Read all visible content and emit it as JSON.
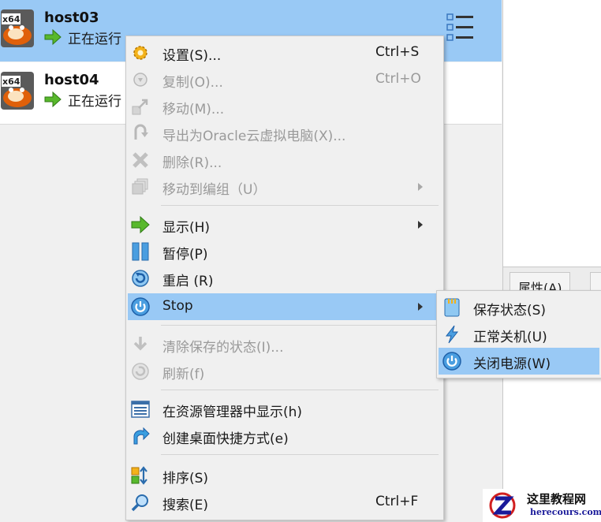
{
  "vms": [
    {
      "name": "host03",
      "status": "正在运行",
      "os_badge": "x64"
    },
    {
      "name": "host04",
      "status": "正在运行",
      "os_badge": "x64"
    }
  ],
  "right_panel": {
    "tab_properties": "属性(A)"
  },
  "context_menu": {
    "items": [
      {
        "label": "设置(S)...",
        "shortcut": "Ctrl+S",
        "icon": "gear-icon",
        "enabled": true
      },
      {
        "label": "复制(O)...",
        "shortcut": "Ctrl+O",
        "icon": "clone-icon",
        "enabled": false
      },
      {
        "label": "移动(M)...",
        "icon": "move-icon",
        "enabled": false
      },
      {
        "label": "导出为Oracle云虚拟电脑(X)...",
        "icon": "export-cloud-icon",
        "enabled": false
      },
      {
        "label": "删除(R)...",
        "icon": "delete-icon",
        "enabled": false
      },
      {
        "label": "移动到编组（U）",
        "icon": "group-icon",
        "enabled": false,
        "submenu": true
      },
      {
        "label": "显示(H)",
        "icon": "show-arrow-icon",
        "enabled": true,
        "submenu": true
      },
      {
        "label": "暂停(P)",
        "icon": "pause-icon",
        "enabled": true
      },
      {
        "label": "重启 (R)",
        "icon": "reset-icon",
        "enabled": true
      },
      {
        "label": "Stop",
        "icon": "power-icon",
        "enabled": true,
        "submenu": true,
        "highlighted": true
      },
      {
        "label": "清除保存的状态(I)...",
        "icon": "discard-state-icon",
        "enabled": false
      },
      {
        "label": "刷新(f)",
        "icon": "refresh-icon",
        "enabled": false
      },
      {
        "label": "在资源管理器中显示(h)",
        "icon": "explorer-icon",
        "enabled": true
      },
      {
        "label": "创建桌面快捷方式(e)",
        "icon": "shortcut-icon",
        "enabled": true
      },
      {
        "label": "排序(S)",
        "icon": "sort-icon",
        "enabled": true
      },
      {
        "label": "搜索(E)",
        "shortcut": "Ctrl+F",
        "icon": "search-icon",
        "enabled": true
      }
    ]
  },
  "stop_submenu": {
    "items": [
      {
        "label": "保存状态(S)",
        "icon": "save-state-icon"
      },
      {
        "label": "正常关机(U)",
        "icon": "acpi-shutdown-icon"
      },
      {
        "label": "关闭电源(W)",
        "icon": "power-off-icon",
        "highlighted": true
      }
    ]
  },
  "watermark": {
    "title": "这里教程网",
    "url": "herecours.com"
  },
  "colors": {
    "highlight": "#99c9f5",
    "disabled_text": "#9a9a9a",
    "menu_bg": "#f0f0f0"
  }
}
